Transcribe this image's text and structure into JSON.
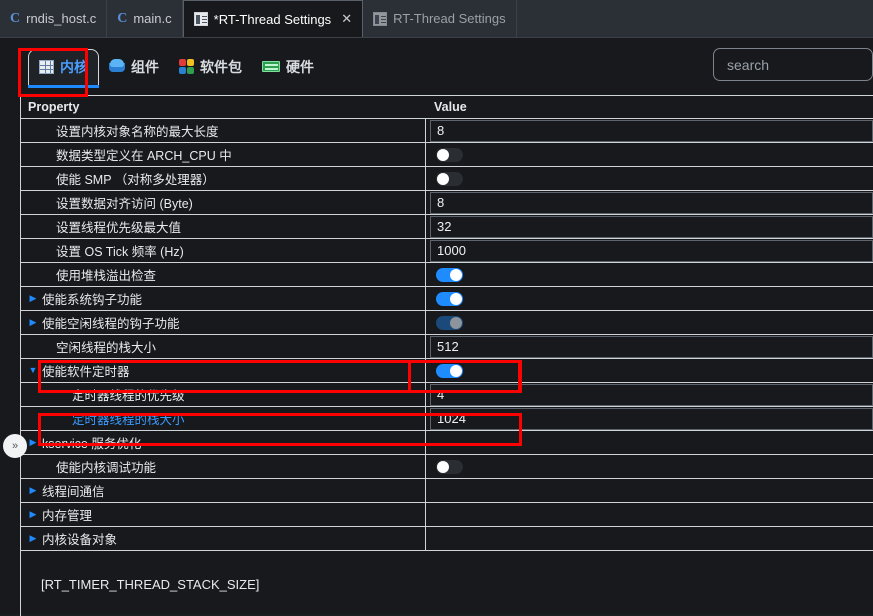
{
  "tabbar": {
    "tabs": [
      {
        "label": "rndis_host.c",
        "icon": "c-file-icon",
        "state": "inactive"
      },
      {
        "label": "main.c",
        "icon": "c-file-icon",
        "state": "inactive"
      },
      {
        "label": "*RT-Thread Settings",
        "icon": "settings-doc-icon",
        "state": "active",
        "close": "✕"
      },
      {
        "label": "RT-Thread Settings",
        "icon": "settings-doc-icon",
        "state": "dim"
      }
    ]
  },
  "toolbar": {
    "tabs": [
      {
        "label": "内核",
        "icon": "kernel-grid-icon",
        "selected": true
      },
      {
        "label": "组件",
        "icon": "components-cube-icon",
        "selected": false
      },
      {
        "label": "软件包",
        "icon": "packages-squares-icon",
        "selected": false
      },
      {
        "label": "硬件",
        "icon": "hardware-chip-icon",
        "selected": false
      }
    ],
    "search_placeholder": "search"
  },
  "table": {
    "header": {
      "property": "Property",
      "value": "Value"
    },
    "rows": [
      {
        "label": "设置内核对象名称的最大长度",
        "indent": 1,
        "arrow": "",
        "type": "input",
        "value": "8"
      },
      {
        "label": "数据类型定义在 ARCH_CPU 中",
        "indent": 1,
        "arrow": "",
        "type": "toggle",
        "toggle": "off"
      },
      {
        "label": "使能 SMP （对称多处理器）",
        "indent": 1,
        "arrow": "",
        "type": "toggle",
        "toggle": "off"
      },
      {
        "label": "设置数据对齐访问 (Byte)",
        "indent": 1,
        "arrow": "",
        "type": "input",
        "value": "8"
      },
      {
        "label": "设置线程优先级最大值",
        "indent": 1,
        "arrow": "",
        "type": "input",
        "value": "32"
      },
      {
        "label": "设置 OS Tick 频率 (Hz)",
        "indent": 1,
        "arrow": "",
        "type": "input",
        "value": "1000"
      },
      {
        "label": "使用堆栈溢出检查",
        "indent": 1,
        "arrow": "",
        "type": "toggle",
        "toggle": "on"
      },
      {
        "label": "使能系统钩子功能",
        "indent": 0,
        "arrow": "▶",
        "type": "toggle",
        "toggle": "on"
      },
      {
        "label": "使能空闲线程的钩子功能",
        "indent": 0,
        "arrow": "▶",
        "type": "toggle",
        "toggle": "dim"
      },
      {
        "label": "空闲线程的栈大小",
        "indent": 1,
        "arrow": "",
        "type": "input",
        "value": "512"
      },
      {
        "label": "使能软件定时器",
        "indent": 0,
        "arrow": "▼",
        "type": "toggle",
        "toggle": "on"
      },
      {
        "label": "定时器线程的优先级",
        "indent": 2,
        "arrow": "",
        "type": "input",
        "value": "4"
      },
      {
        "label": "定时器线程的栈大小",
        "indent": 2,
        "arrow": "",
        "type": "input",
        "value": "1024",
        "selected": true
      },
      {
        "label": "kservice 服务优化",
        "indent": 0,
        "arrow": "▶",
        "type": "none"
      },
      {
        "label": "使能内核调试功能",
        "indent": 1,
        "arrow": "",
        "type": "toggle",
        "toggle": "off"
      },
      {
        "label": "线程间通信",
        "indent": 0,
        "arrow": "▶",
        "type": "none"
      },
      {
        "label": "内存管理",
        "indent": 0,
        "arrow": "▶",
        "type": "none"
      },
      {
        "label": "内核设备对象",
        "indent": 0,
        "arrow": "▶",
        "type": "none"
      }
    ]
  },
  "status": {
    "text": "[RT_TIMER_THREAD_STACK_SIZE]"
  },
  "handle": {
    "glyph": "»"
  },
  "colors": {
    "accent_blue": "#1e8bff",
    "selected_text": "#3b9bff",
    "annotation_red": "#ff0000",
    "panel_bg": "#17191c",
    "tabbar_bg": "#2b3036",
    "grid_line": "#cfd4d9"
  }
}
